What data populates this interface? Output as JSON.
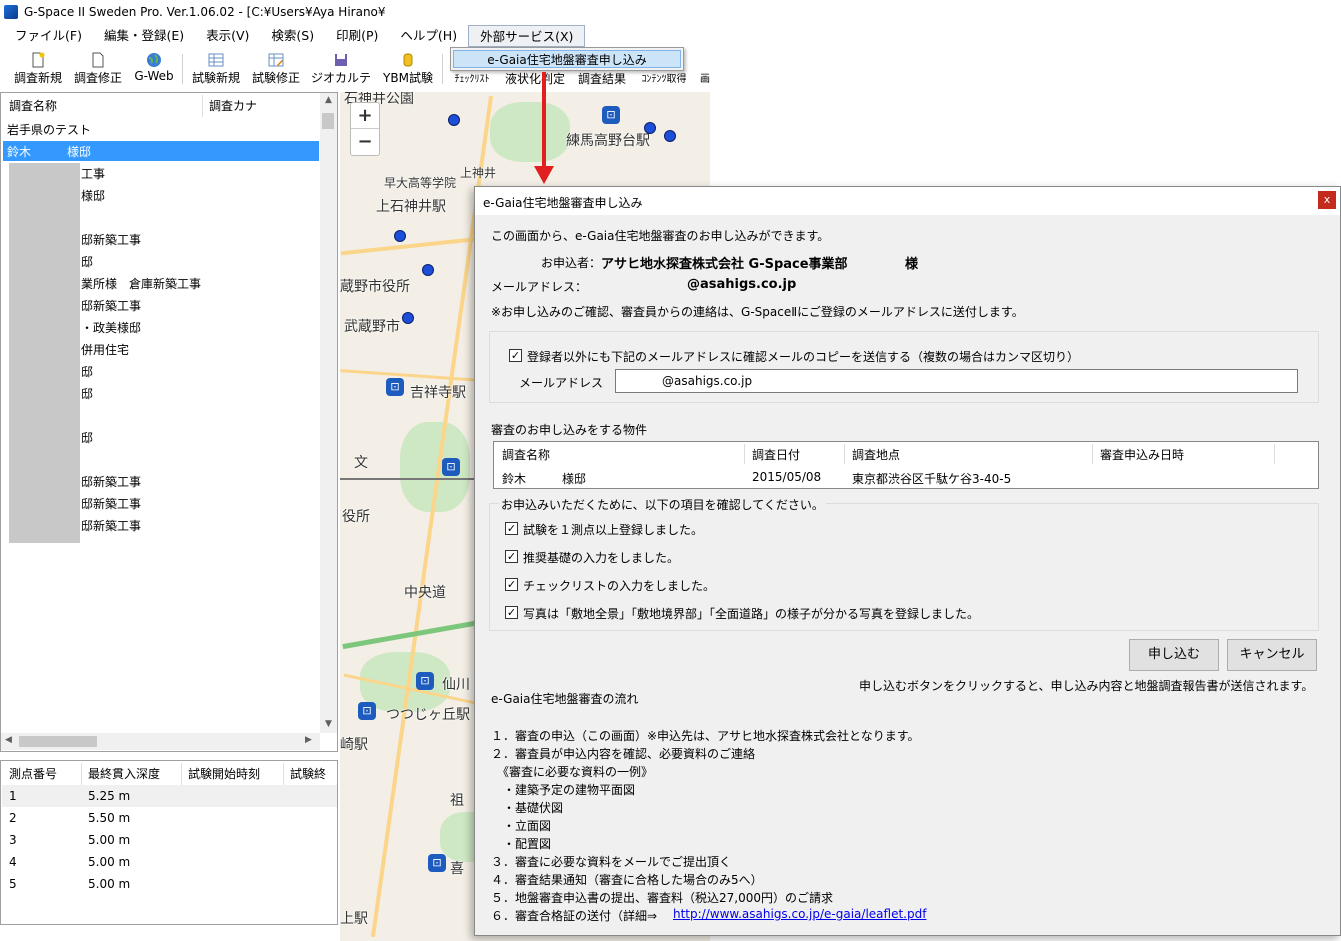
{
  "app": {
    "title": "G-Space II  Sweden Pro. Ver.1.06.02 - [C:¥Users¥Aya Hirano¥"
  },
  "menu": {
    "items": [
      "ファイル(F)",
      "編集・登録(E)",
      "表示(V)",
      "検索(S)",
      "印刷(P)",
      "ヘルプ(H)",
      "外部サービス(X)"
    ],
    "dropdown_item": "e-Gaia住宅地盤審査申し込み"
  },
  "toolbar": {
    "buttons": [
      "調査新規",
      "調査修正",
      "G-Web",
      "試験新規",
      "試験修正",
      "ジオカルテ",
      "YBM試験"
    ],
    "small_buttons": [
      "ﾁｪｯｸﾘｽﾄ",
      "液状化判定",
      "調査結果",
      "ｺﾝﾃﾝﾂ取得",
      "画"
    ]
  },
  "survey_list": {
    "headers": [
      "調査名称",
      "調査カナ"
    ],
    "rows": [
      "岩手県のテスト",
      "鈴木　　　様邸",
      "工事",
      "様邸",
      "",
      "邸新築工事",
      "邸",
      "業所様　倉庫新築工事",
      "邸新築工事",
      "・政美様邸",
      "併用住宅",
      "邸",
      "邸",
      "",
      "邸",
      "",
      "邸新築工事",
      "邸新築工事",
      "邸新築工事"
    ]
  },
  "test_grid": {
    "headers": [
      "測点番号",
      "最終貫入深度",
      "試験開始時刻",
      "試験終了"
    ],
    "rows": [
      [
        "1",
        "5.25 m"
      ],
      [
        "2",
        "5.50 m"
      ],
      [
        "3",
        "5.00 m"
      ],
      [
        "4",
        "5.00 m"
      ],
      [
        "5",
        "5.00 m"
      ]
    ]
  },
  "map": {
    "labels": [
      "石神井公園",
      "練馬高野台駅",
      "早大高等学院",
      "上石神井駅",
      "蔵野市役所",
      "武蔵野市",
      "吉祥寺駅",
      "文",
      "役所",
      "中央道",
      "仙川",
      "つつじヶ丘駅",
      "崎駅",
      "祖",
      "喜",
      "上駅",
      "上神井"
    ],
    "zoom_in": "+",
    "zoom_out": "−"
  },
  "dialog": {
    "title": "e-Gaia住宅地盤審査申し込み",
    "close": "x",
    "intro": "この画面から、e-Gaia住宅地盤審査のお申し込みができます。",
    "applicant_label": "お申込者：",
    "applicant_value": "アサヒ地水探査株式会社 G-Space事業部",
    "applicant_suffix": "様",
    "email_label": "メールアドレス：",
    "email_value": "@asahigs.co.jp",
    "notice": "※お申し込みのご確認、審査員からの連絡は、G-SpaceⅡにご登録のメールアドレスに送付します。",
    "copy_checkbox": "登録者以外にも下記のメールアドレスに確認メールのコピーを送信する（複数の場合はカンマ区切り）",
    "copy_email_label": "メールアドレス",
    "copy_email_value": "@asahigs.co.jp",
    "property_title": "審査のお申し込みをする物件",
    "property_headers": [
      "調査名称",
      "調査日付",
      "調査地点",
      "審査申込み日時"
    ],
    "property_row": [
      "鈴木　　　様邸",
      "2015/05/08",
      "東京都渋谷区千駄ケ谷3-40-5",
      ""
    ],
    "confirm_title": "お申込みいただくために、以下の項目を確認してください。",
    "confirm_items": [
      "試験を１測点以上登録しました。",
      "推奨基礎の入力をしました。",
      "チェックリストの入力をしました。",
      "写真は「敷地全景」「敷地境界部」「全面道路」の様子が分かる写真を登録しました。"
    ],
    "submit": "申し込む",
    "cancel": "キャンセル",
    "submit_note": "申し込むボタンをクリックすると、申し込み内容と地盤調査報告書が送信されます。",
    "flow_title": "e-Gaia住宅地盤審査の流れ",
    "flow": [
      "１．審査の申込（この画面）※申込先は、アサヒ地水探査株式会社となります。",
      "２．審査員が申込内容を確認、必要資料のご連絡",
      "　《審査に必要な資料の一例》",
      "　・建築予定の建物平面図",
      "　・基礎伏図",
      "　・立面図",
      "　・配置図",
      "３．審査に必要な資料をメールでご提出頂く",
      "４．審査結果通知（審査に合格した場合のみ5へ）",
      "５．地盤審査申込書の提出、審査料（税込27,000円）のご請求",
      "６．審査合格証の送付（詳細⇒"
    ],
    "flow_link": "http://www.asahigs.co.jp/e-gaia/leaflet.pdf"
  }
}
